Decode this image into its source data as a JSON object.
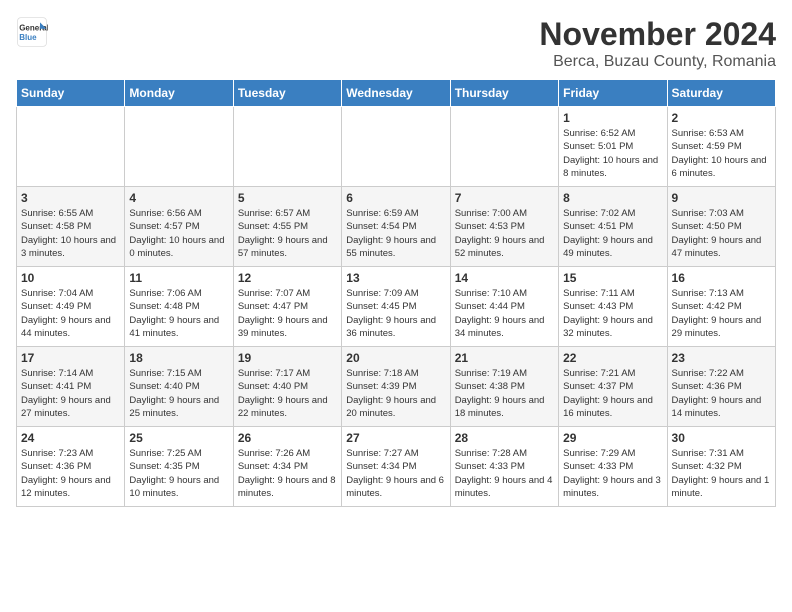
{
  "logo": {
    "general": "General",
    "blue": "Blue"
  },
  "title": "November 2024",
  "subtitle": "Berca, Buzau County, Romania",
  "days_of_week": [
    "Sunday",
    "Monday",
    "Tuesday",
    "Wednesday",
    "Thursday",
    "Friday",
    "Saturday"
  ],
  "weeks": [
    [
      {
        "day": "",
        "info": ""
      },
      {
        "day": "",
        "info": ""
      },
      {
        "day": "",
        "info": ""
      },
      {
        "day": "",
        "info": ""
      },
      {
        "day": "",
        "info": ""
      },
      {
        "day": "1",
        "info": "Sunrise: 6:52 AM\nSunset: 5:01 PM\nDaylight: 10 hours and 8 minutes."
      },
      {
        "day": "2",
        "info": "Sunrise: 6:53 AM\nSunset: 4:59 PM\nDaylight: 10 hours and 6 minutes."
      }
    ],
    [
      {
        "day": "3",
        "info": "Sunrise: 6:55 AM\nSunset: 4:58 PM\nDaylight: 10 hours and 3 minutes."
      },
      {
        "day": "4",
        "info": "Sunrise: 6:56 AM\nSunset: 4:57 PM\nDaylight: 10 hours and 0 minutes."
      },
      {
        "day": "5",
        "info": "Sunrise: 6:57 AM\nSunset: 4:55 PM\nDaylight: 9 hours and 57 minutes."
      },
      {
        "day": "6",
        "info": "Sunrise: 6:59 AM\nSunset: 4:54 PM\nDaylight: 9 hours and 55 minutes."
      },
      {
        "day": "7",
        "info": "Sunrise: 7:00 AM\nSunset: 4:53 PM\nDaylight: 9 hours and 52 minutes."
      },
      {
        "day": "8",
        "info": "Sunrise: 7:02 AM\nSunset: 4:51 PM\nDaylight: 9 hours and 49 minutes."
      },
      {
        "day": "9",
        "info": "Sunrise: 7:03 AM\nSunset: 4:50 PM\nDaylight: 9 hours and 47 minutes."
      }
    ],
    [
      {
        "day": "10",
        "info": "Sunrise: 7:04 AM\nSunset: 4:49 PM\nDaylight: 9 hours and 44 minutes."
      },
      {
        "day": "11",
        "info": "Sunrise: 7:06 AM\nSunset: 4:48 PM\nDaylight: 9 hours and 41 minutes."
      },
      {
        "day": "12",
        "info": "Sunrise: 7:07 AM\nSunset: 4:47 PM\nDaylight: 9 hours and 39 minutes."
      },
      {
        "day": "13",
        "info": "Sunrise: 7:09 AM\nSunset: 4:45 PM\nDaylight: 9 hours and 36 minutes."
      },
      {
        "day": "14",
        "info": "Sunrise: 7:10 AM\nSunset: 4:44 PM\nDaylight: 9 hours and 34 minutes."
      },
      {
        "day": "15",
        "info": "Sunrise: 7:11 AM\nSunset: 4:43 PM\nDaylight: 9 hours and 32 minutes."
      },
      {
        "day": "16",
        "info": "Sunrise: 7:13 AM\nSunset: 4:42 PM\nDaylight: 9 hours and 29 minutes."
      }
    ],
    [
      {
        "day": "17",
        "info": "Sunrise: 7:14 AM\nSunset: 4:41 PM\nDaylight: 9 hours and 27 minutes."
      },
      {
        "day": "18",
        "info": "Sunrise: 7:15 AM\nSunset: 4:40 PM\nDaylight: 9 hours and 25 minutes."
      },
      {
        "day": "19",
        "info": "Sunrise: 7:17 AM\nSunset: 4:40 PM\nDaylight: 9 hours and 22 minutes."
      },
      {
        "day": "20",
        "info": "Sunrise: 7:18 AM\nSunset: 4:39 PM\nDaylight: 9 hours and 20 minutes."
      },
      {
        "day": "21",
        "info": "Sunrise: 7:19 AM\nSunset: 4:38 PM\nDaylight: 9 hours and 18 minutes."
      },
      {
        "day": "22",
        "info": "Sunrise: 7:21 AM\nSunset: 4:37 PM\nDaylight: 9 hours and 16 minutes."
      },
      {
        "day": "23",
        "info": "Sunrise: 7:22 AM\nSunset: 4:36 PM\nDaylight: 9 hours and 14 minutes."
      }
    ],
    [
      {
        "day": "24",
        "info": "Sunrise: 7:23 AM\nSunset: 4:36 PM\nDaylight: 9 hours and 12 minutes."
      },
      {
        "day": "25",
        "info": "Sunrise: 7:25 AM\nSunset: 4:35 PM\nDaylight: 9 hours and 10 minutes."
      },
      {
        "day": "26",
        "info": "Sunrise: 7:26 AM\nSunset: 4:34 PM\nDaylight: 9 hours and 8 minutes."
      },
      {
        "day": "27",
        "info": "Sunrise: 7:27 AM\nSunset: 4:34 PM\nDaylight: 9 hours and 6 minutes."
      },
      {
        "day": "28",
        "info": "Sunrise: 7:28 AM\nSunset: 4:33 PM\nDaylight: 9 hours and 4 minutes."
      },
      {
        "day": "29",
        "info": "Sunrise: 7:29 AM\nSunset: 4:33 PM\nDaylight: 9 hours and 3 minutes."
      },
      {
        "day": "30",
        "info": "Sunrise: 7:31 AM\nSunset: 4:32 PM\nDaylight: 9 hours and 1 minute."
      }
    ]
  ]
}
